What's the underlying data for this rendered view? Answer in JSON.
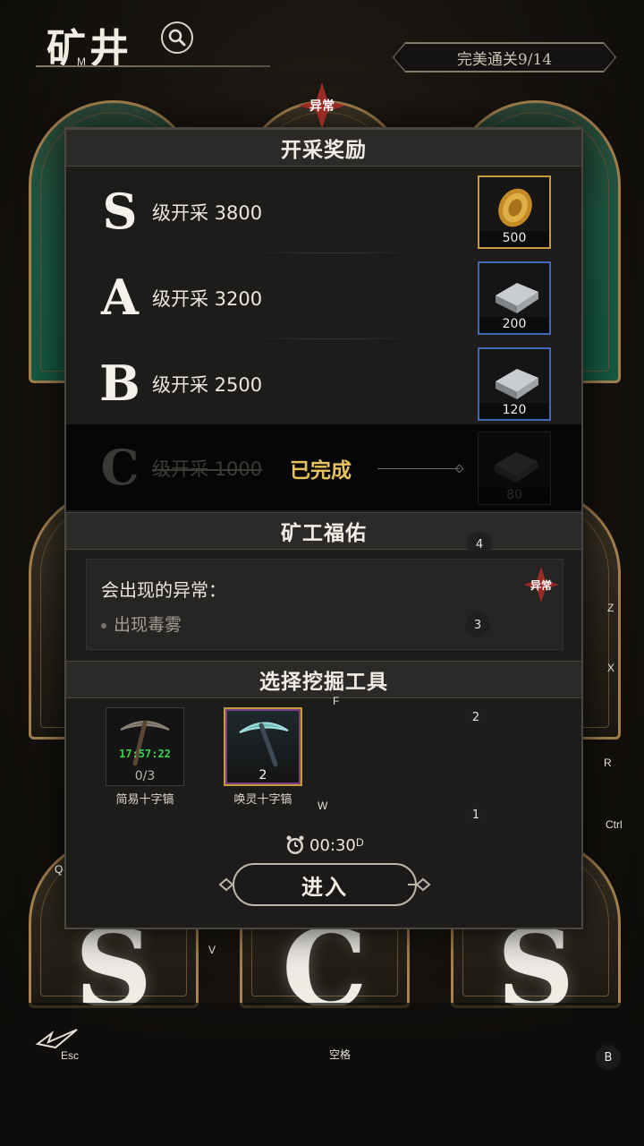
{
  "header": {
    "title": "矿井",
    "progress_text": "完美通关9/14"
  },
  "background_cards": [
    {
      "letter": "S"
    },
    {
      "letter": "C"
    },
    {
      "letter": "S"
    }
  ],
  "modal": {
    "anomaly_badge": "异常",
    "rewards_title": "开采奖励",
    "rewards": [
      {
        "grade": "S",
        "label": "级开采 3800",
        "item": "gold-coin-icon",
        "qty": "500",
        "rarity_color": "#c99a3c"
      },
      {
        "grade": "A",
        "label": "级开采 3200",
        "item": "silver-ingot-icon",
        "qty": "200",
        "rarity_color": "#3d67b8"
      },
      {
        "grade": "B",
        "label": "级开采 2500",
        "item": "silver-ingot-icon",
        "qty": "120",
        "rarity_color": "#3d67b8"
      },
      {
        "grade": "C",
        "label": "级开采 1000",
        "item": "silver-ingot-icon",
        "qty": "80",
        "completed": true
      }
    ],
    "completed_text": "已完成",
    "blessing_title": "矿工福佑",
    "blessing": {
      "heading": "会出现的异常：",
      "badge": "异常",
      "items": [
        "出现毒雾"
      ]
    },
    "tools_title": "选择挖掘工具",
    "tools": [
      {
        "name": "简易十字镐",
        "count": "0/3",
        "timer": "17:57:22",
        "selected": false
      },
      {
        "name": "唤灵十字镐",
        "count": "2",
        "selected": true
      }
    ],
    "timer": "00:30",
    "enter_label": "进入"
  },
  "key_hints": {
    "m": "M",
    "f": "F",
    "w": "W",
    "d": "D",
    "q": "Q",
    "v": "V",
    "z": "Z",
    "x": "X",
    "r": "R",
    "ctrl": "Ctrl",
    "esc": "Esc",
    "space": "空格",
    "b": "B",
    "n1": "1",
    "n2": "2",
    "n3": "3",
    "n4": "4"
  },
  "colors": {
    "accent_gold": "#e6c15e",
    "anomaly_red": "#9c2a24",
    "timer_green": "#3bd24c"
  }
}
